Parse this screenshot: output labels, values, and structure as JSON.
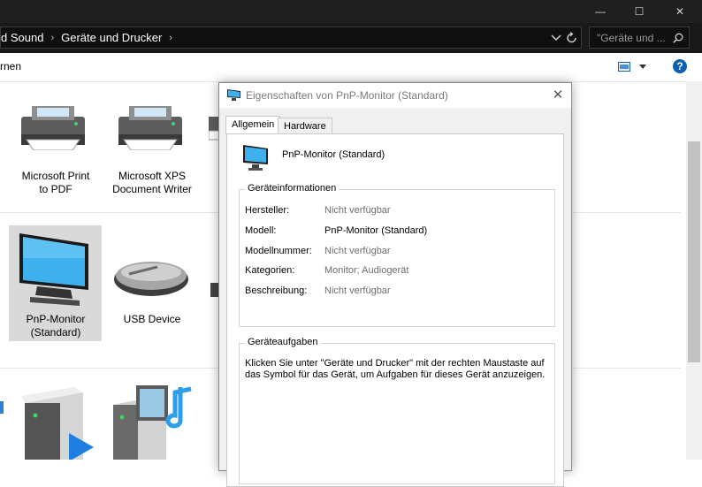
{
  "window": {
    "minimize_glyph": "—",
    "maximize_glyph": "☐",
    "close_glyph": "✕"
  },
  "address": {
    "crumb1": "d Sound",
    "crumb2": "Geräte und Drucker",
    "search_placeholder": "\"Geräte und ...",
    "dropdown_icon": "chevron-down-icon",
    "refresh_icon": "refresh-icon"
  },
  "command": {
    "left_label": "rnen",
    "help_label": "?"
  },
  "devices": {
    "printer1": "Microsoft Print to PDF",
    "printer1_l1": "Microsoft Print",
    "printer1_l2": "to PDF",
    "printer2_l1": "Microsoft XPS",
    "printer2_l2": "Document Writer",
    "monitor_l1": "PnP-Monitor",
    "monitor_l2": "(Standard)",
    "usb": "USB Device"
  },
  "dialog": {
    "title": "Eigenschaften von PnP-Monitor (Standard)",
    "tabs": [
      "Allgemein",
      "Hardware"
    ],
    "device_name": "PnP-Monitor (Standard)",
    "info_group": "Geräteinformationen",
    "rows": [
      {
        "label": "Hersteller:",
        "value": "Nicht verfügbar"
      },
      {
        "label": "Modell:",
        "value": "PnP-Monitor (Standard)"
      },
      {
        "label": "Modellnummer:",
        "value": "Nicht verfügbar"
      },
      {
        "label": "Kategorien:",
        "value": "Monitor; Audiogerät"
      },
      {
        "label": "Beschreibung:",
        "value": "Nicht verfügbar"
      }
    ],
    "tasks_group": "Geräteaufgaben",
    "tasks_text": "Klicken Sie unter \"Geräte und Drucker\" mit der rechten Maustaste auf das Symbol für das Gerät, um Aufgaben für dieses Gerät anzuzeigen."
  },
  "colors": {
    "accent": "#0a5fb4",
    "monitor_screen": "#3fb0ee",
    "titlebar": "#1f1f1f"
  }
}
